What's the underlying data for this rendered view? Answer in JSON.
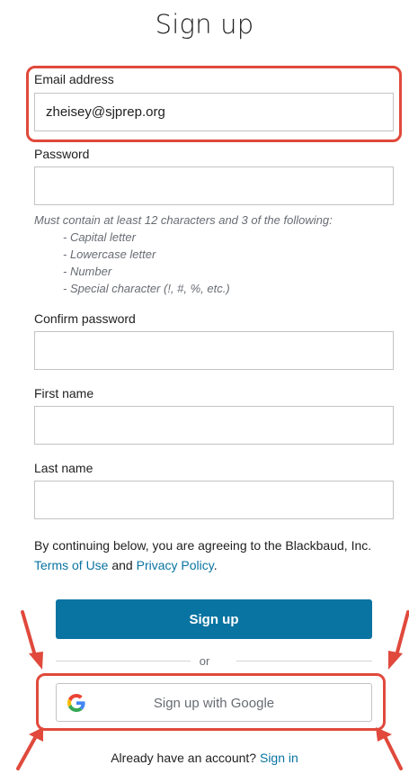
{
  "page": {
    "title": "Sign up"
  },
  "form": {
    "email": {
      "label": "Email address",
      "value": "zheisey@sjprep.org"
    },
    "password": {
      "label": "Password",
      "value": "",
      "hint": "Must contain at least 12 characters and 3 of the following:",
      "rules": [
        "- Capital letter",
        "- Lowercase letter",
        "- Number",
        "- Special character (!, #, %, etc.)"
      ]
    },
    "confirm_password": {
      "label": "Confirm password",
      "value": ""
    },
    "first_name": {
      "label": "First name",
      "value": ""
    },
    "last_name": {
      "label": "Last name",
      "value": ""
    }
  },
  "terms": {
    "prefix": "By continuing below, you are agreeing to the Blackbaud, Inc.",
    "terms_link": "Terms of Use",
    "and": "and",
    "privacy_link": "Privacy Policy",
    "suffix": "."
  },
  "actions": {
    "sign_up_label": "Sign up",
    "or_label": "or",
    "google_label": "Sign up with Google"
  },
  "footer": {
    "prompt": "Already have an account?",
    "sign_in_link": "Sign in"
  },
  "colors": {
    "accent": "#0974a1",
    "annotation": "#e0493c"
  },
  "icons": {
    "google": "google-icon",
    "annotation_arrow": "arrow-icon"
  }
}
